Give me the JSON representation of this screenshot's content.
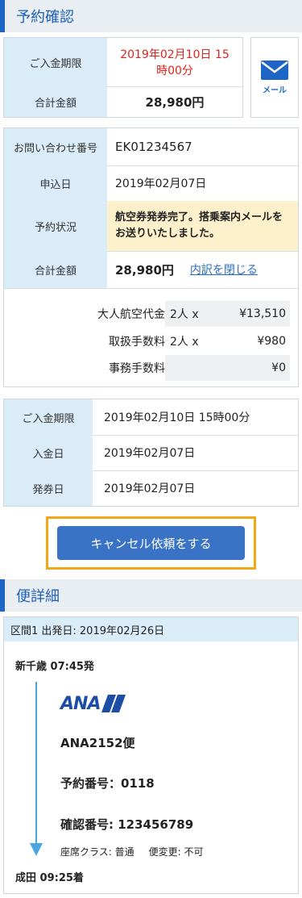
{
  "reservation": {
    "title": "予約確認",
    "deadline_label": "ご入金期限",
    "deadline_value": "2019年02月10日 15時00分",
    "total_label": "合計金額",
    "total_value": "28,980円",
    "mail_label": "メール"
  },
  "details": {
    "inquiry_label": "お問い合わせ番号",
    "inquiry_value": "EK01234567",
    "apply_label": "申込日",
    "apply_value": "2019年02月07日",
    "status_label": "予約状況",
    "status_value": "航空券発券完了。搭乗案内メールをお送りいたしました。",
    "total_label": "合計金額",
    "total_value": "28,980円",
    "breakdown_link": "内訳を閉じる",
    "breakdown": [
      {
        "name": "大人航空代金",
        "qty": "2人 x",
        "amount": "¥13,510"
      },
      {
        "name": "取扱手数料",
        "qty": "2人 x",
        "amount": "¥980"
      },
      {
        "name": "事務手数料",
        "qty": "",
        "amount": "¥0"
      }
    ]
  },
  "payment": {
    "deadline_label": "ご入金期限",
    "deadline_value": "2019年02月10日 15時00分",
    "paid_label": "入金日",
    "paid_value": "2019年02月07日",
    "issued_label": "発券日",
    "issued_value": "2019年02月07日"
  },
  "cancel_button": "キャンセル依頼をする",
  "flight": {
    "title": "便詳細",
    "segment_header": "区間1 出発日: 2019年02月26日",
    "departure": "新千歳 07:45発",
    "airline_logo": "ANA",
    "flight_no": "ANA2152便",
    "booking_no": "予約番号：0118",
    "confirm_no": "確認番号: 123456789",
    "seat_class": "座席クラス: 普通",
    "change": "便変更: 不可",
    "arrival": "成田 09:25着",
    "colors": {
      "accent": "#1e66c6",
      "label_bg": "#d9ecf7",
      "status_bg": "#fdf1cc",
      "deadline_red": "#e0231d",
      "cancel_border": "#f0a818",
      "arrow": "#4aa6e0"
    }
  }
}
